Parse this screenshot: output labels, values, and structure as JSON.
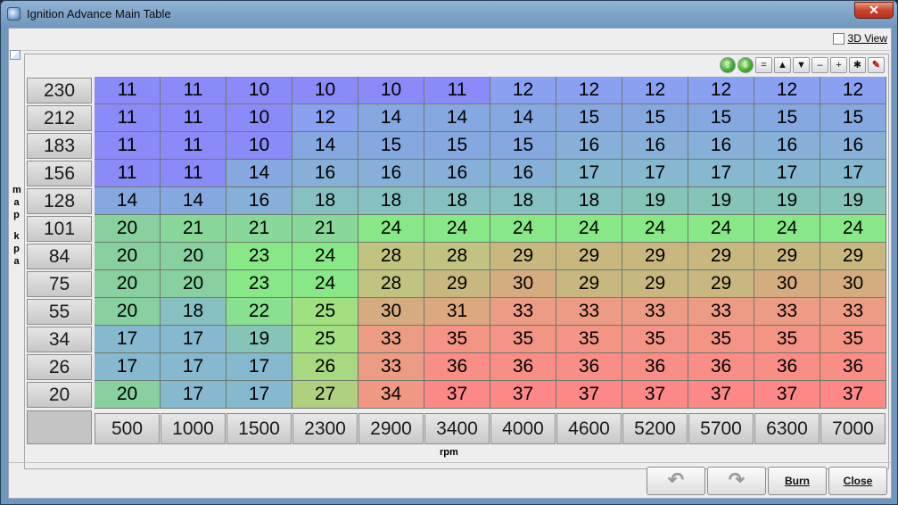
{
  "window": {
    "title": "Ignition Advance Main Table",
    "close_label": "✕"
  },
  "options": {
    "view3d_label": "3D View"
  },
  "toolbar": {
    "buttons": [
      {
        "name": "increase-all-button",
        "glyph": "⇧"
      },
      {
        "name": "decrease-all-button",
        "glyph": "⇩"
      },
      {
        "name": "set-equal-button",
        "glyph": "="
      },
      {
        "name": "shift-up-button",
        "glyph": "▲"
      },
      {
        "name": "shift-down-button",
        "glyph": "▼"
      },
      {
        "name": "subtract-button",
        "glyph": "–"
      },
      {
        "name": "add-button",
        "glyph": "+"
      },
      {
        "name": "multiply-button",
        "glyph": "✱"
      },
      {
        "name": "pencil-button",
        "glyph": "✎"
      }
    ]
  },
  "axes": {
    "y_label": "map kpa",
    "x_label": "rpm",
    "y_values": [
      "230",
      "212",
      "183",
      "156",
      "128",
      "101",
      "84",
      "75",
      "55",
      "34",
      "26",
      "20"
    ],
    "x_values": [
      "500",
      "1000",
      "1500",
      "2300",
      "2900",
      "3400",
      "4000",
      "4600",
      "5200",
      "5700",
      "6300",
      "7000"
    ]
  },
  "table": {
    "rows": [
      [
        "11",
        "11",
        "10",
        "10",
        "10",
        "11",
        "12",
        "12",
        "12",
        "12",
        "12",
        "12"
      ],
      [
        "11",
        "11",
        "10",
        "12",
        "14",
        "14",
        "14",
        "15",
        "15",
        "15",
        "15",
        "15"
      ],
      [
        "11",
        "11",
        "10",
        "14",
        "15",
        "15",
        "15",
        "16",
        "16",
        "16",
        "16",
        "16"
      ],
      [
        "11",
        "11",
        "14",
        "16",
        "16",
        "16",
        "16",
        "17",
        "17",
        "17",
        "17",
        "17"
      ],
      [
        "14",
        "14",
        "16",
        "18",
        "18",
        "18",
        "18",
        "18",
        "19",
        "19",
        "19",
        "19"
      ],
      [
        "20",
        "21",
        "21",
        "21",
        "24",
        "24",
        "24",
        "24",
        "24",
        "24",
        "24",
        "24"
      ],
      [
        "20",
        "20",
        "23",
        "24",
        "28",
        "28",
        "29",
        "29",
        "29",
        "29",
        "29",
        "29"
      ],
      [
        "20",
        "20",
        "23",
        "24",
        "28",
        "29",
        "30",
        "29",
        "29",
        "29",
        "30",
        "30"
      ],
      [
        "20",
        "18",
        "22",
        "25",
        "30",
        "31",
        "33",
        "33",
        "33",
        "33",
        "33",
        "33"
      ],
      [
        "17",
        "17",
        "19",
        "25",
        "33",
        "35",
        "35",
        "35",
        "35",
        "35",
        "35",
        "35"
      ],
      [
        "17",
        "17",
        "17",
        "26",
        "33",
        "36",
        "36",
        "36",
        "36",
        "36",
        "36",
        "36"
      ],
      [
        "20",
        "17",
        "17",
        "27",
        "34",
        "37",
        "37",
        "37",
        "37",
        "37",
        "37",
        "37"
      ]
    ],
    "colors": {
      "10": "#8a8af8",
      "11": "#8a8af8",
      "12": "#8aa0f0",
      "14": "#86a8e0",
      "15": "#86a8e0",
      "16": "#86b0d8",
      "17": "#86b8d0",
      "18": "#86c0c0",
      "19": "#86c4b8",
      "20": "#88d0a0",
      "21": "#88d89a",
      "22": "#88e090",
      "23": "#88e888",
      "24": "#88e888",
      "25": "#a0e080",
      "26": "#a8d880",
      "27": "#b0d080",
      "28": "#c0c480",
      "29": "#c8b880",
      "30": "#d4ac80",
      "31": "#dca880",
      "33": "#ec9c84",
      "34": "#f09884",
      "35": "#f49484",
      "36": "#f88e86",
      "37": "#fc8888"
    }
  },
  "buttons": {
    "undo_glyph": "↶",
    "redo_glyph": "↷",
    "burn_label": "Burn",
    "close_label": "Close"
  }
}
